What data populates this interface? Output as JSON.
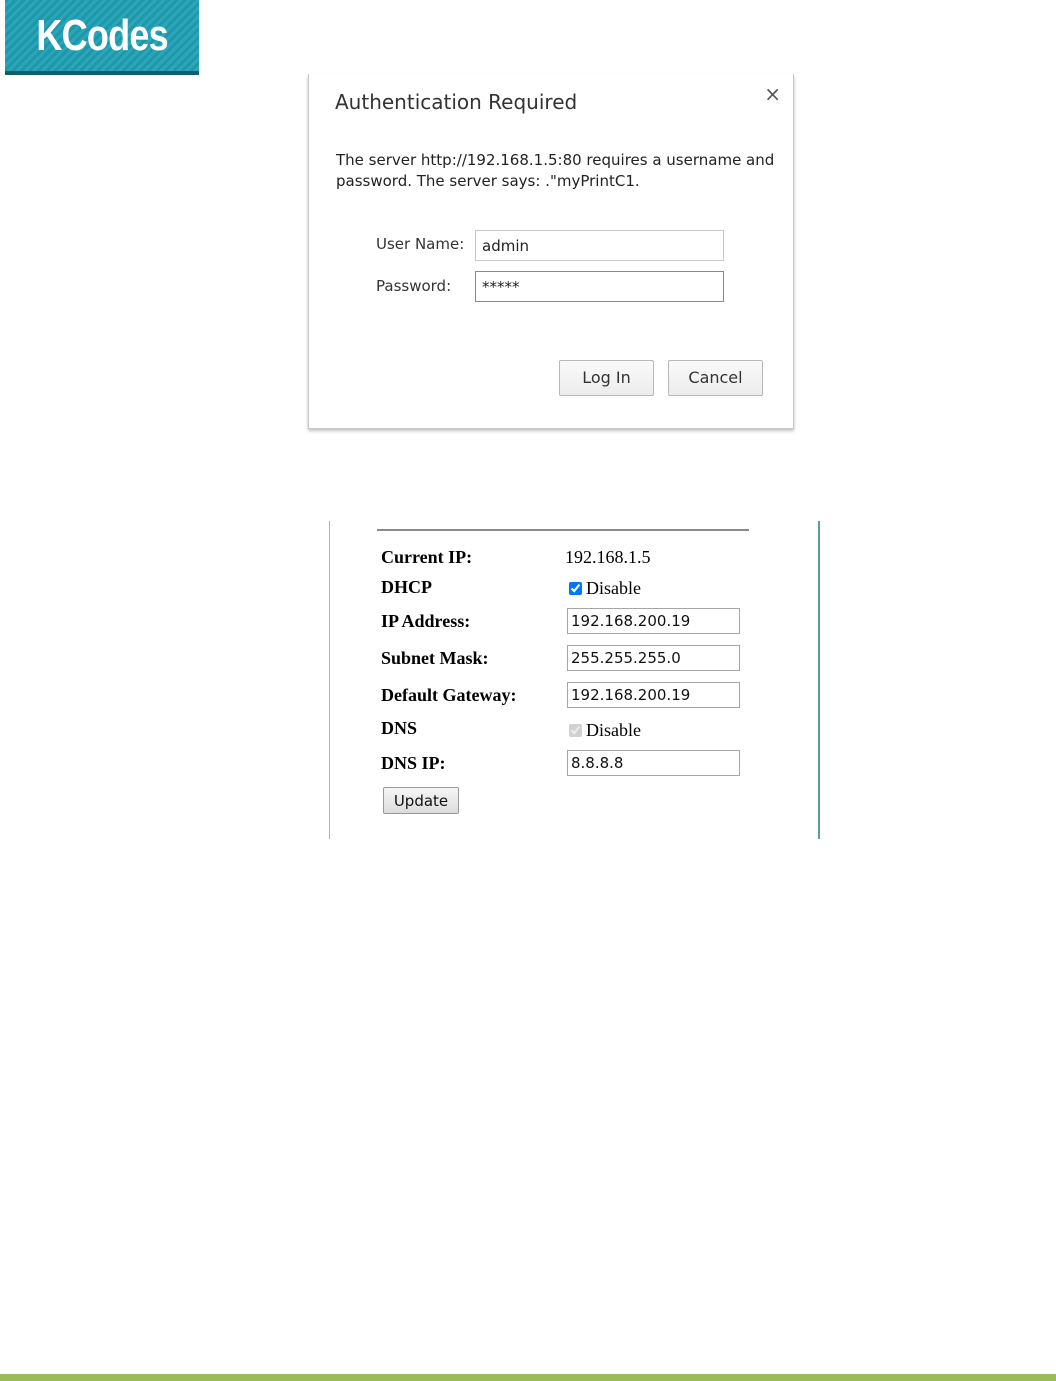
{
  "logo": {
    "text": "KCodes"
  },
  "auth_dialog": {
    "title": "Authentication Required",
    "close_glyph": "×",
    "message": "The server http://192.168.1.5:80 requires a username and password. The server says: .\"myPrintC1.",
    "username_label": "User Name:",
    "username_value": "admin",
    "password_label": "Password:",
    "password_value": "*****",
    "login_label": "Log In",
    "cancel_label": "Cancel"
  },
  "network_settings": {
    "current_ip_label": "Current IP:",
    "current_ip_value": "192.168.1.5",
    "dhcp_label": "DHCP",
    "dhcp_checkbox_label": "Disable",
    "dhcp_checked": true,
    "ip_address_label": "IP Address:",
    "ip_address_value": "192.168.200.19",
    "subnet_mask_label": "Subnet Mask:",
    "subnet_mask_value": "255.255.255.0",
    "default_gateway_label": "Default Gateway:",
    "default_gateway_value": "192.168.200.19",
    "dns_label": "DNS",
    "dns_checkbox_label": "Disable",
    "dns_checked": true,
    "dns_ip_label": "DNS IP:",
    "dns_ip_value": "8.8.8.8",
    "update_label": "Update"
  },
  "colors": {
    "logo_bg": "#1f97aa",
    "footer_bar": "#9bbb59",
    "focus_border": "#4d90fe"
  }
}
